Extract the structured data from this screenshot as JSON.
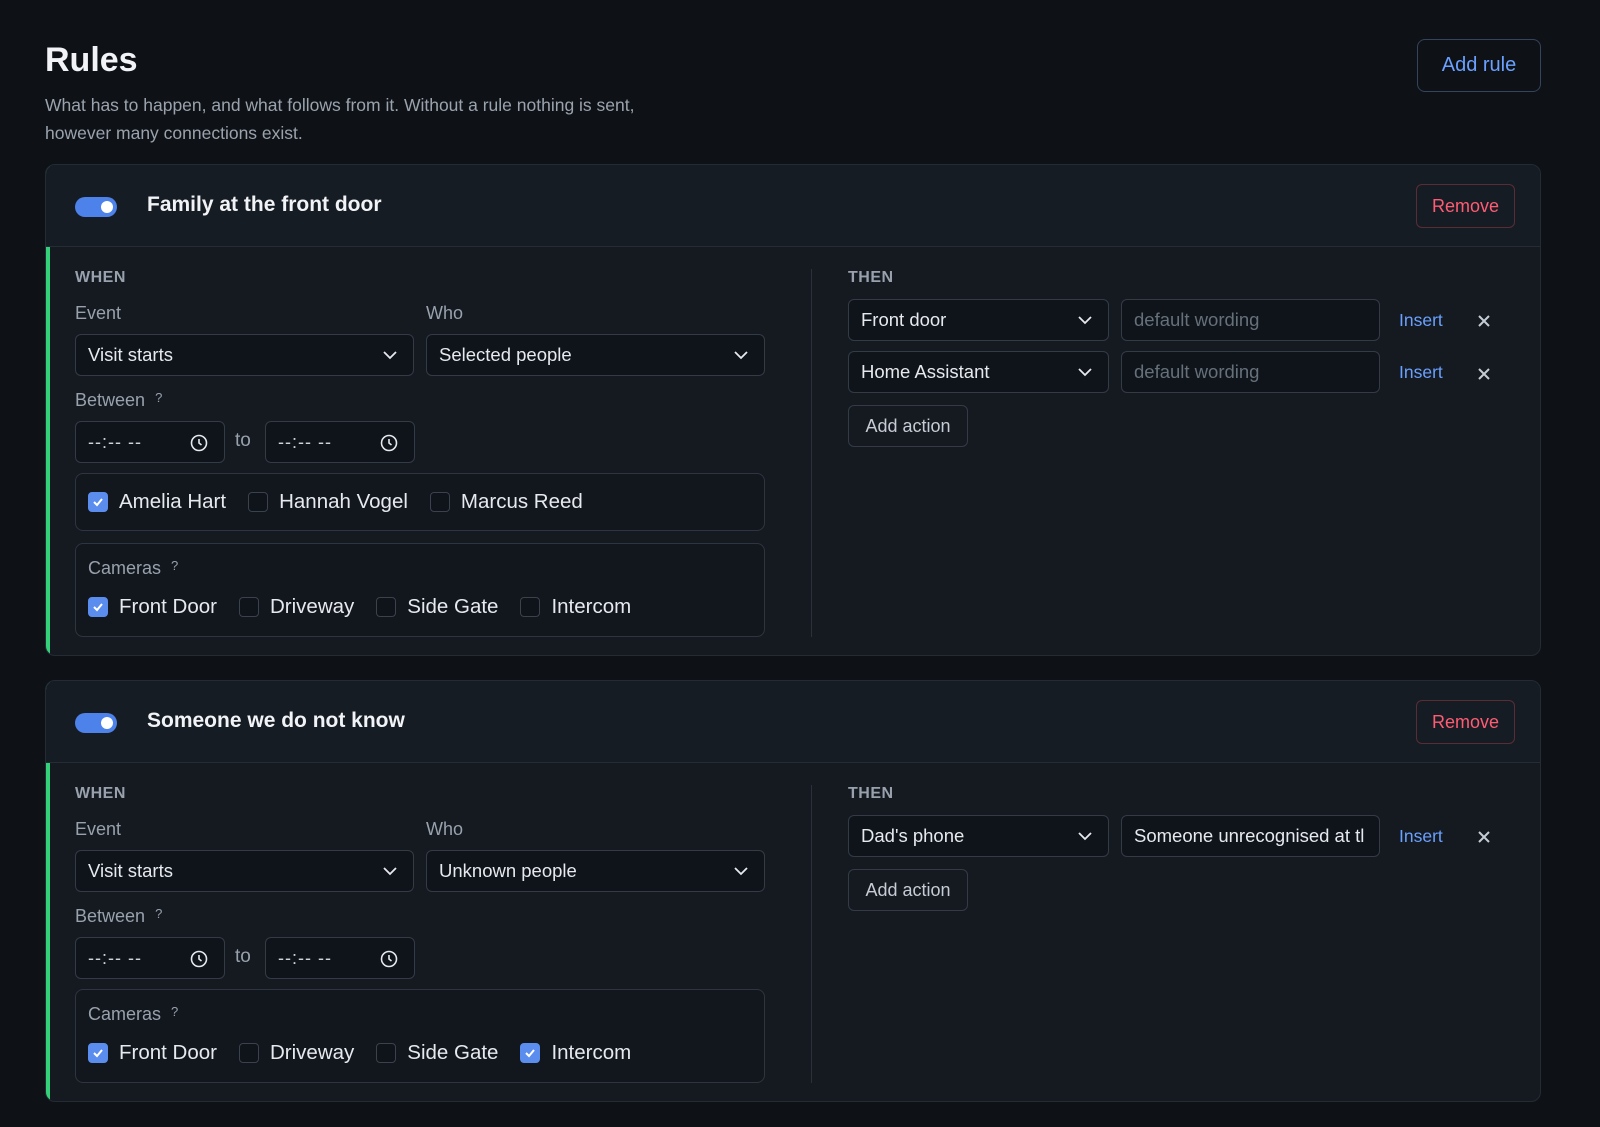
{
  "header": {
    "title": "Rules",
    "subtitle": "What has to happen, and what follows from it. Without a rule nothing is sent, however many connections exist.",
    "add_rule_label": "Add rule"
  },
  "labels": {
    "when": "WHEN",
    "then": "THEN",
    "event": "Event",
    "who": "Who",
    "between": "Between",
    "to": "to",
    "cameras": "Cameras",
    "help": "?",
    "remove": "Remove",
    "insert": "Insert",
    "add_action": "Add action",
    "time_placeholder": "--:-- --"
  },
  "rules": [
    {
      "enabled": true,
      "name": "Family at the front door",
      "event": "Visit starts",
      "who": "Selected people",
      "people": [
        {
          "name": "Amelia Hart",
          "checked": true
        },
        {
          "name": "Hannah Vogel",
          "checked": false
        },
        {
          "name": "Marcus Reed",
          "checked": false
        }
      ],
      "cameras": [
        {
          "name": "Front Door",
          "checked": true
        },
        {
          "name": "Driveway",
          "checked": false
        },
        {
          "name": "Side Gate",
          "checked": false
        },
        {
          "name": "Intercom",
          "checked": false
        }
      ],
      "actions": [
        {
          "target": "Front door",
          "wording": "",
          "wording_placeholder": "default wording"
        },
        {
          "target": "Home Assistant",
          "wording": "",
          "wording_placeholder": "default wording"
        }
      ]
    },
    {
      "enabled": true,
      "name": "Someone we do not know",
      "event": "Visit starts",
      "who": "Unknown people",
      "cameras": [
        {
          "name": "Front Door",
          "checked": true
        },
        {
          "name": "Driveway",
          "checked": false
        },
        {
          "name": "Side Gate",
          "checked": false
        },
        {
          "name": "Intercom",
          "checked": true
        }
      ],
      "actions": [
        {
          "target": "Dad's phone",
          "wording": "Someone unrecognised at tl",
          "wording_placeholder": ""
        }
      ]
    }
  ],
  "colors": {
    "accent": "#5b8def",
    "link": "#6aa0ff",
    "danger": "#ff5c73",
    "active_bar": "#34d17a"
  }
}
